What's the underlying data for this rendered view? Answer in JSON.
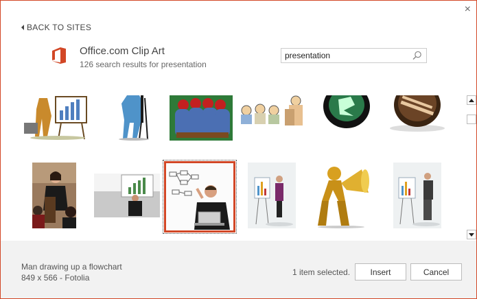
{
  "dialog": {
    "close_label": "×",
    "back_label": "BACK TO SITES",
    "source_title": "Office.com Clip Art",
    "result_summary": "126 search results for presentation",
    "brand_color": "#d24726"
  },
  "search": {
    "value": "presentation",
    "icon": "search-icon"
  },
  "results": [
    {
      "id": "r1",
      "icon": "clipart-businessman-chart"
    },
    {
      "id": "r2",
      "icon": "clipart-man-easel"
    },
    {
      "id": "r3",
      "icon": "clipart-audience"
    },
    {
      "id": "r4",
      "icon": "clipart-speaker-audience"
    },
    {
      "id": "r5",
      "icon": "clipart-green-emblem"
    },
    {
      "id": "r6",
      "icon": "clipart-presentation-badge"
    },
    {
      "id": "r7",
      "icon": "photo-woman-presenting"
    },
    {
      "id": "r8",
      "icon": "photo-man-board"
    },
    {
      "id": "r9",
      "icon": "photo-man-flowchart",
      "selected": true
    },
    {
      "id": "r10",
      "icon": "photo-woman-flipchart"
    },
    {
      "id": "r11",
      "icon": "clipart-gold-megaphone"
    },
    {
      "id": "r12",
      "icon": "photo-man-flipchart"
    }
  ],
  "footer": {
    "item_name": "Man drawing up a flowchart",
    "item_details": "849 x 566 - Fotolia",
    "selection_count": "1 item selected.",
    "insert_label": "Insert",
    "cancel_label": "Cancel"
  }
}
